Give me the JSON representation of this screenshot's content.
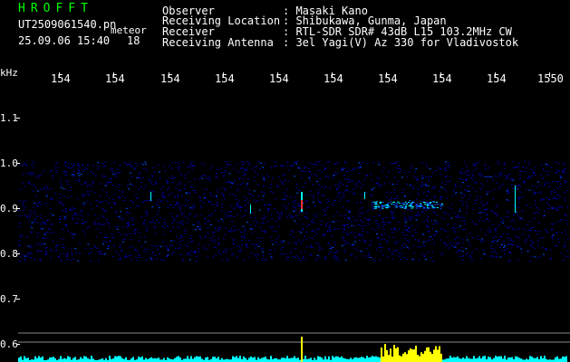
{
  "header": {
    "program": "HROFFT",
    "filename": "UT2509061540.pn",
    "tag": "meteor",
    "datetime": "25.09.06 15:40",
    "number": "18",
    "fields": [
      {
        "label": "Observer",
        "value": ": Masaki Kano"
      },
      {
        "label": "Receiving Location",
        "value": ": Shibukawa, Gunma, Japan"
      },
      {
        "label": "Receiver",
        "value": ": RTL-SDR SDR# 43dB L15 103.2MHz CW"
      },
      {
        "label": "Receiving Antenna",
        "value": ": 3el Yagi(V) Az 330 for Vladivostok"
      }
    ]
  },
  "axes": {
    "unit": "kHz",
    "x_ticks": [
      "154",
      "154",
      "154",
      "154",
      "154",
      "154",
      "154",
      "154",
      "154",
      "1550"
    ],
    "y_ticks": [
      "1.1",
      "1.0",
      "0.9",
      "0.8",
      "0.7",
      "0.6"
    ]
  },
  "colors": {
    "background": "#000000",
    "title": "#00ff00",
    "noise_low": "#0000a0",
    "noise_mid": "#0050ff",
    "echo": "#00ffff",
    "signal_strong": "#ff3030",
    "spectrum": "#00ffff",
    "spectrum_peak": "#ffff00"
  }
}
